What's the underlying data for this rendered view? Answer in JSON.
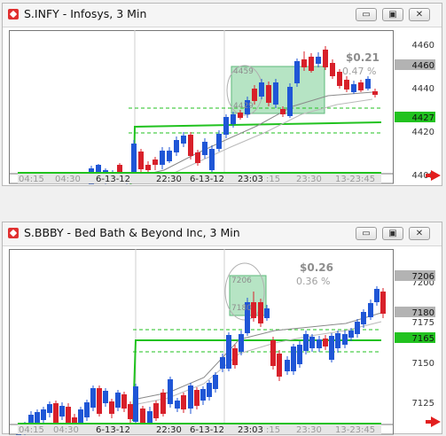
{
  "windows": [
    {
      "title": "S.INFY - Infosys, 3 Min",
      "buttons": {
        "minimize": "▭",
        "maximize": "▣",
        "close": "✕"
      },
      "price_labels": [
        {
          "text": "4460",
          "kind": "gray"
        },
        {
          "text": "4429",
          "kind": "plain"
        },
        {
          "text": "4427",
          "kind": "green"
        }
      ],
      "axis_ticks": [
        "4460",
        "4440",
        "4420",
        "4400"
      ],
      "change": {
        "amount": "$0.21",
        "percent": "0.47 %"
      },
      "box_labels": [
        "4459",
        "4429"
      ],
      "time_labels": [
        "04:15",
        "04:30",
        "6-13-12",
        "22:30",
        "6-13-12",
        "23:03",
        ":15",
        "23:30",
        "13-23:45"
      ],
      "colors": {
        "up": "#1f56d6",
        "down": "#d8202a",
        "green": "#21c21f",
        "box": "#8fd6a4"
      }
    },
    {
      "title": "S.BBBY - Bed Bath & Beyond Inc, 3 Min",
      "buttons": {
        "minimize": "▭",
        "maximize": "▣",
        "close": "✕"
      },
      "price_labels": [
        {
          "text": "7206",
          "kind": "gray"
        },
        {
          "text": "7180",
          "kind": "gray"
        },
        {
          "text": "7165",
          "kind": "green"
        }
      ],
      "axis_ticks": [
        "7200",
        "7175",
        "7150",
        "7125"
      ],
      "change": {
        "amount": "$0.26",
        "percent": "0.36 %"
      },
      "box_labels": [
        "7206",
        "7180"
      ],
      "time_labels": [
        "04:15",
        "04:30",
        "6-13-12",
        "22:30",
        "6-13-12",
        "23:03",
        ":15",
        "23:30",
        "13-23:45"
      ],
      "colors": {
        "up": "#1f56d6",
        "down": "#d8202a",
        "green": "#21c21f",
        "box": "#8fd6a4"
      }
    }
  ]
}
